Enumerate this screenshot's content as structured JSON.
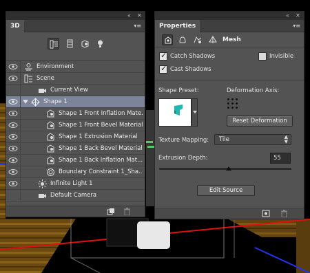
{
  "panel3d": {
    "tab": "3D",
    "collapse_glyph": "«",
    "close_glyph": "✕",
    "menu_glyph": "▾≡",
    "filters": [
      {
        "icon": "scene-filter-icon",
        "active": true
      },
      {
        "icon": "mesh-filter-icon",
        "active": false
      },
      {
        "icon": "material-filter-icon",
        "active": false
      },
      {
        "icon": "light-filter-icon",
        "active": false
      }
    ],
    "layers": [
      {
        "label": "Environment",
        "icon": "environment-icon",
        "visible": true
      },
      {
        "label": "Scene",
        "icon": "scene-icon",
        "visible": true
      },
      {
        "label": "Current View",
        "icon": "camera-icon",
        "visible": false
      },
      {
        "label": "Shape 1",
        "icon": "mesh-icon",
        "visible": true,
        "selected": true,
        "expanded": true
      },
      {
        "label": "Shape 1 Front Inflation Mate...",
        "icon": "material-icon",
        "visible": true
      },
      {
        "label": "Shape 1 Front Bevel Material",
        "icon": "material-icon",
        "visible": true
      },
      {
        "label": "Shape 1 Extrusion Material",
        "icon": "material-icon",
        "visible": true
      },
      {
        "label": "Shape 1 Back Bevel Material",
        "icon": "material-icon",
        "visible": true
      },
      {
        "label": "Shape 1 Back Inflation Mat...",
        "icon": "material-icon",
        "visible": true
      },
      {
        "label": "Boundary Constraint 1_Sha...",
        "icon": "constraint-icon",
        "visible": true
      },
      {
        "label": "Infinite Light 1",
        "icon": "infinite-light-icon",
        "visible": true
      },
      {
        "label": "Default Camera",
        "icon": "camera-icon",
        "visible": false
      }
    ]
  },
  "properties": {
    "tab": "Properties",
    "collapse_glyph": "«",
    "close_glyph": "✕",
    "menu_glyph": "▾≡",
    "mode": "Mesh",
    "catch_shadows": {
      "label": "Catch Shadows",
      "checked": true
    },
    "cast_shadows": {
      "label": "Cast Shadows",
      "checked": true
    },
    "invisible": {
      "label": "Invisible",
      "checked": false
    },
    "shape_preset_label": "Shape Preset:",
    "deformation_axis_label": "Deformation Axis:",
    "reset_deformation": "Reset Deformation",
    "texture_mapping_label": "Texture Mapping:",
    "texture_mapping_value": "Tile",
    "extrusion_depth_label": "Extrusion Depth:",
    "extrusion_depth_value": "55",
    "edit_source": "Edit Source"
  },
  "check_glyph": "✓"
}
